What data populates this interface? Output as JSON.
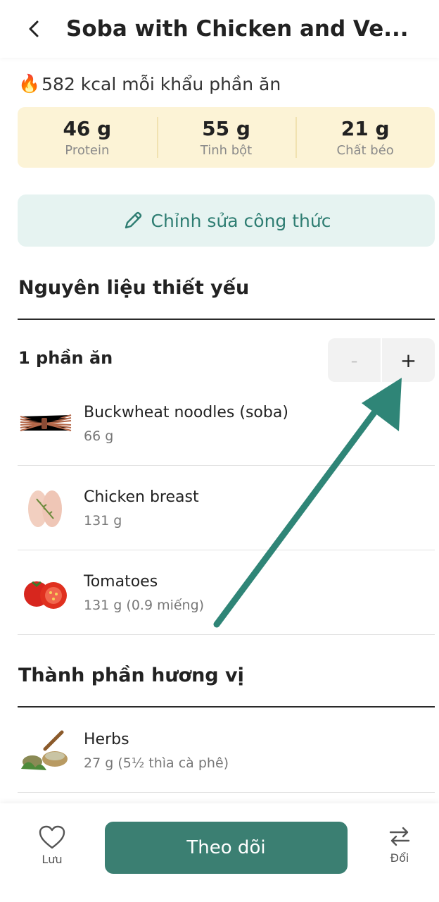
{
  "header": {
    "title": "Soba with Chicken and Ve..."
  },
  "nutrition": {
    "kcal_text": "582 kcal mỗi khẩu phần ăn",
    "macros": [
      {
        "value": "46 g",
        "label": "Protein"
      },
      {
        "value": "55 g",
        "label": "Tinh bột"
      },
      {
        "value": "21 g",
        "label": "Chất béo"
      }
    ]
  },
  "edit_button": {
    "label": "Chỉnh sửa công thức"
  },
  "essential": {
    "title": "Nguyên liệu thiết yếu",
    "servings_label": "1 phần ăn",
    "stepper_minus": "-",
    "stepper_plus": "+",
    "items": [
      {
        "name": "Buckwheat noodles (soba)",
        "amount": "66 g"
      },
      {
        "name": "Chicken breast",
        "amount": "131 g"
      },
      {
        "name": "Tomatoes",
        "amount": "131 g (0.9 miếng)"
      }
    ]
  },
  "flavor": {
    "title": "Thành phần hương vị",
    "items": [
      {
        "name": "Herbs",
        "amount": "27 g (5½ thìa cà phê)"
      }
    ]
  },
  "bottom_bar": {
    "save_label": "Lưu",
    "follow_label": "Theo dõi",
    "swap_label": "Đổi"
  },
  "colors": {
    "accent": "#3b7f72",
    "macro_bg": "#fcf3d6",
    "edit_bg": "#e6f3f1",
    "annotation_arrow": "#2f8577"
  }
}
